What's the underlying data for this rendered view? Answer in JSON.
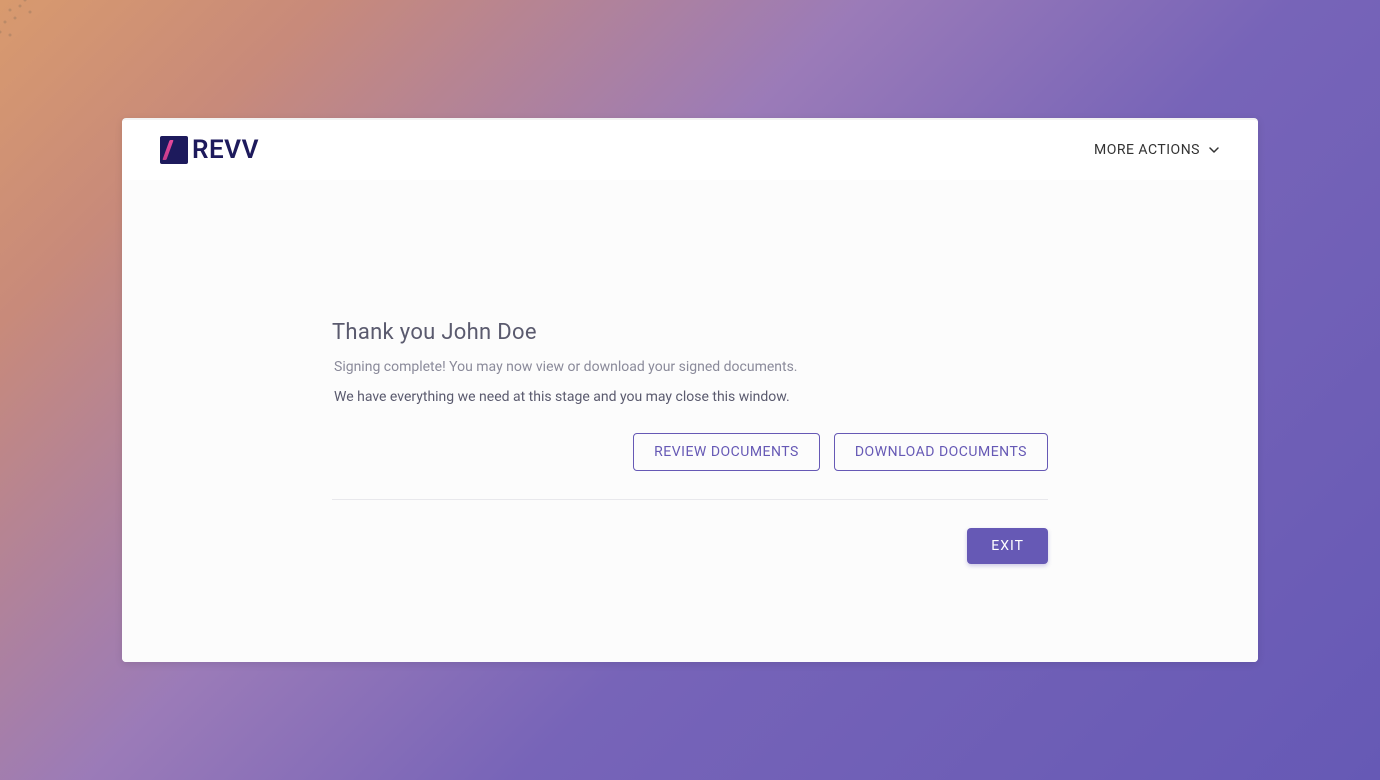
{
  "header": {
    "logo_text": "REVV",
    "more_actions_label": "MORE ACTIONS"
  },
  "content": {
    "title": "Thank you John Doe",
    "subtitle": "Signing complete! You may now view or download your signed documents.",
    "description": "We have everything we need at this stage and you may close this window.",
    "review_button_label": "REVIEW DOCUMENTS",
    "download_button_label": "DOWNLOAD DOCUMENTS",
    "exit_button_label": "EXIT"
  },
  "colors": {
    "accent": "#6659b5",
    "logo_bg": "#1d1a5c",
    "logo_slash": "#e84a9c"
  }
}
